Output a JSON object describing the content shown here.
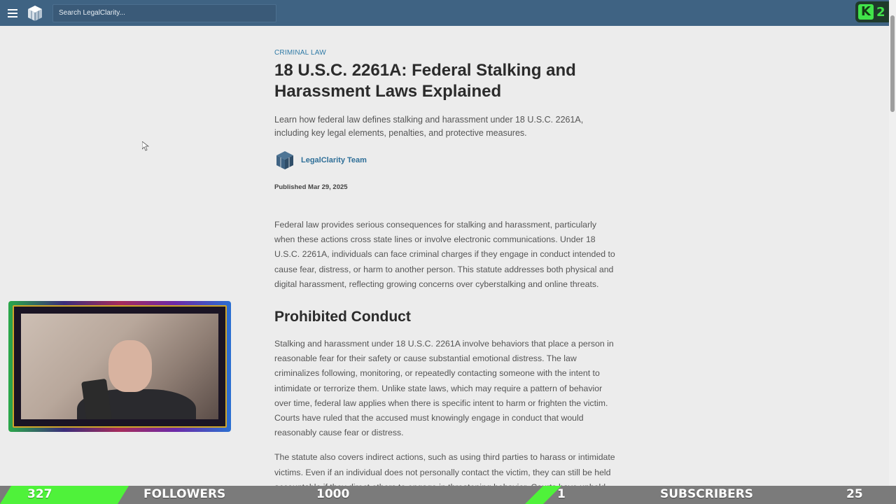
{
  "header": {
    "search_placeholder": "Search LegalClarity..."
  },
  "badge": {
    "letter": "K",
    "number": "2"
  },
  "article": {
    "category": "CRIMINAL LAW",
    "title": "18 U.S.C. 2261A: Federal Stalking and Harassment Laws Explained",
    "lede": "Learn how federal law defines stalking and harassment under 18 U.S.C. 2261A, including key legal elements, penalties, and protective measures.",
    "author": "LegalClarity Team",
    "published": "Published Mar 29, 2025",
    "p1": "Federal law provides serious consequences for stalking and harassment, particularly when these actions cross state lines or involve electronic communications. Under 18 U.S.C. 2261A, individuals can face criminal charges if they engage in conduct intended to cause fear, distress, or harm to another person. This statute addresses both physical and digital harassment, reflecting growing concerns over cyberstalking and online threats.",
    "heading": "Prohibited Conduct",
    "p2": "Stalking and harassment under 18 U.S.C. 2261A involve behaviors that place a person in reasonable fear for their safety or cause substantial emotional distress. The law criminalizes following, monitoring, or repeatedly contacting someone with the intent to intimidate or terrorize them. Unlike state laws, which may require a pattern of behavior over time, federal law applies when there is specific intent to harm or frighten the victim. Courts have ruled that the accused must knowingly engage in conduct that would reasonably cause fear or distress.",
    "p3": "The statute also covers indirect actions, such as using third parties to harass or intimidate victims. Even if an individual does not personally contact the victim, they can still be held accountable if they direct others to engage in threatening behavior. Courts have upheld convictions where perpetrators orchestrated campaigns of intimidation through"
  },
  "stats": {
    "followers_count": "327",
    "followers_label": "FOLLOWERS",
    "followers_goal": "1000",
    "subscribers_count": "1",
    "subscribers_label": "SUBSCRIBERS",
    "subscribers_goal": "25"
  }
}
